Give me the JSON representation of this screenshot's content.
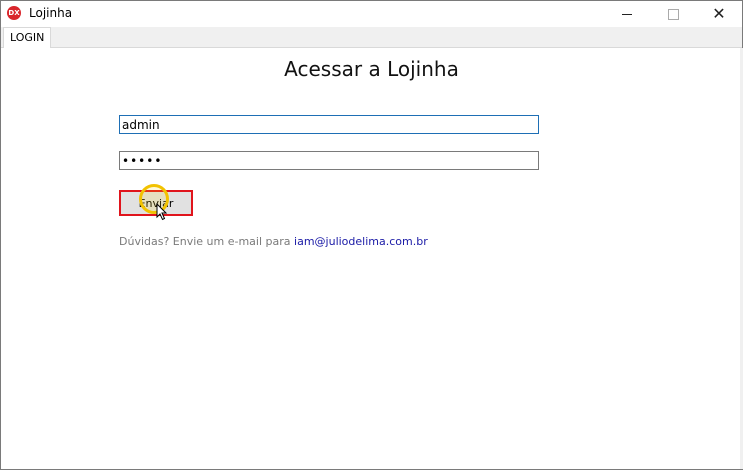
{
  "window": {
    "title": "Lojinha",
    "icon_text": "DX"
  },
  "tabs": [
    {
      "label": "LOGIN",
      "active": true
    }
  ],
  "login": {
    "heading": "Acessar a Lojinha",
    "username_value": "admin",
    "password_value": "•••••",
    "submit_label": "Enviar",
    "help_text": "Dúvidas? Envie um e-mail para",
    "help_email": "iam@juliodelima.com.br"
  },
  "colors": {
    "accent_red": "#e0141c",
    "link_blue": "#1a1aa6",
    "focus_blue": "#1e6fb5",
    "click_highlight": "#f2c200"
  },
  "icons": {
    "app": "app-logo-icon",
    "minimize": "minimize-icon",
    "maximize": "maximize-icon",
    "close": "close-icon",
    "cursor": "mouse-pointer-icon"
  }
}
